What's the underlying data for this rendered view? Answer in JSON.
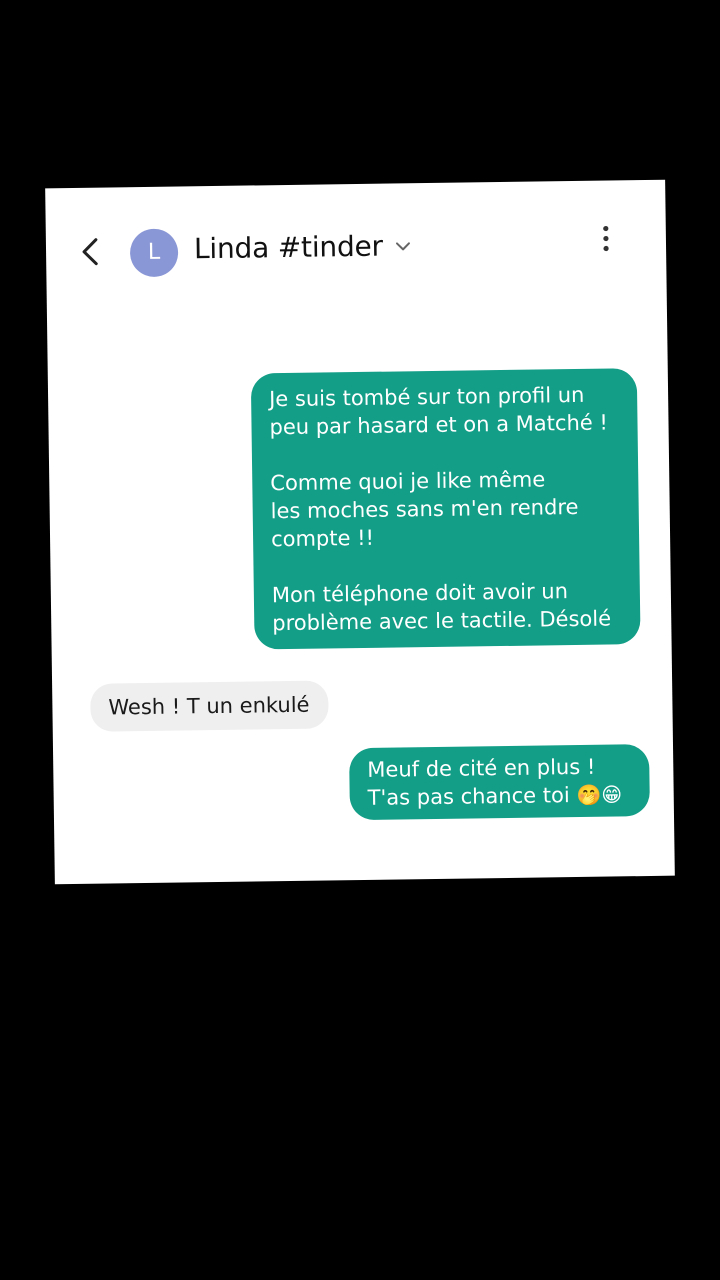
{
  "header": {
    "back_icon": "chevron-left-icon",
    "avatar_letter": "L",
    "avatar_color": "#8a97d6",
    "contact_name": "Linda #tinder",
    "dropdown_icon": "chevron-down-icon",
    "more_icon": "more-vertical-icon"
  },
  "colors": {
    "outgoing_bubble": "#139e87",
    "incoming_bubble": "#efefef",
    "background": "#000000",
    "card": "#ffffff"
  },
  "messages": [
    {
      "direction": "outgoing",
      "paragraphs": [
        [
          "Je suis tombé sur ton profil un",
          "peu par hasard et on a Matché !"
        ],
        [
          "Comme quoi je like même",
          "les moches sans m'en rendre",
          "compte !!"
        ],
        [
          "Mon téléphone doit avoir un",
          "problème avec le tactile. Désolé"
        ]
      ]
    },
    {
      "direction": "incoming",
      "text": "Wesh ! T un enkulé"
    },
    {
      "direction": "outgoing",
      "lines": [
        "Meuf de cité en plus !",
        "T'as pas chance toi"
      ],
      "emojis": "🤭😁"
    }
  ]
}
